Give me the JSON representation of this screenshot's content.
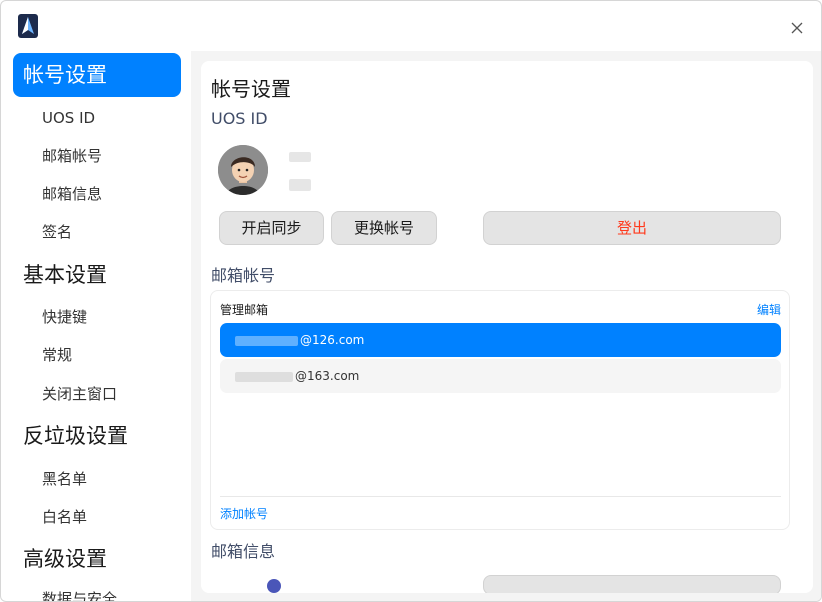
{
  "sidebar": {
    "groups": [
      {
        "label": "帐号设置",
        "items": [
          "UOS ID",
          "邮箱帐号",
          "邮箱信息",
          "签名"
        ]
      },
      {
        "label": "基本设置",
        "items": [
          "快捷键",
          "常规",
          "关闭主窗口"
        ]
      },
      {
        "label": "反垃圾设置",
        "items": [
          "黑名单",
          "白名单"
        ]
      },
      {
        "label": "高级设置",
        "items": [
          "数据与安全"
        ]
      }
    ]
  },
  "content": {
    "title": "帐号设置",
    "uos_section": "UOS ID",
    "buttons": {
      "sync": "开启同步",
      "switch": "更换帐号",
      "logout": "登出"
    },
    "mail_section": "邮箱帐号",
    "mailbox": {
      "header": "管理邮箱",
      "edit": "编辑",
      "accounts": [
        {
          "domain": "@126.com",
          "selected": true
        },
        {
          "domain": "@163.com",
          "selected": false
        }
      ],
      "add": "添加帐号"
    },
    "info_section": "邮箱信息"
  },
  "colors": {
    "accent": "#0081ff",
    "danger": "#ff3a1d"
  }
}
